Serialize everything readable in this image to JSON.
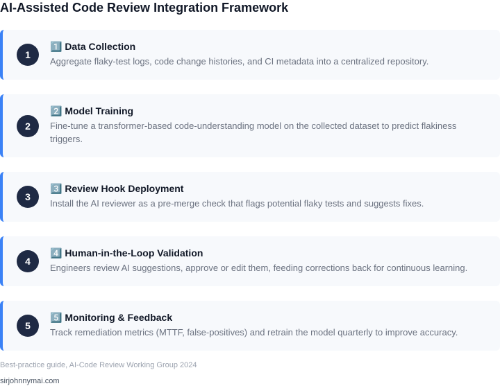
{
  "page_title": "AI-Assisted Code Review Integration Framework",
  "accent_color": "#3b82f6",
  "badge_color": "#1f2a44",
  "steps": [
    {
      "number": "1",
      "title": "1️⃣ Data Collection",
      "description": "Aggregate flaky-test logs, code change histories, and CI metadata into a centralized repository."
    },
    {
      "number": "2",
      "title": "2️⃣ Model Training",
      "description": "Fine-tune a transformer-based code-understanding model on the collected dataset to predict flakiness triggers."
    },
    {
      "number": "3",
      "title": "3️⃣ Review Hook Deployment",
      "description": "Install the AI reviewer as a pre-merge check that flags potential flaky tests and suggests fixes."
    },
    {
      "number": "4",
      "title": "4️⃣ Human-in-the-Loop Validation",
      "description": "Engineers review AI suggestions, approve or edit them, feeding corrections back for continuous learning."
    },
    {
      "number": "5",
      "title": "5️⃣ Monitoring & Feedback",
      "description": "Track remediation metrics (MTTF, false-positives) and retrain the model quarterly to improve accuracy."
    }
  ],
  "source_note": "Best-practice guide, AI-Code Review Working Group 2024",
  "author": "sirjohnnymai.com"
}
